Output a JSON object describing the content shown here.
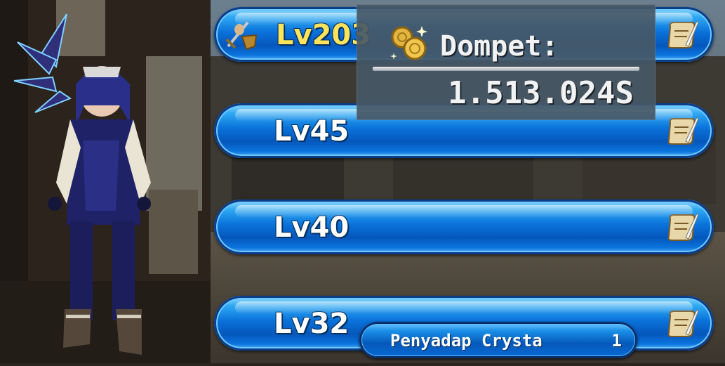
{
  "characters": [
    {
      "level": "Lv203"
    },
    {
      "level": "Lv45"
    },
    {
      "level": "Lv40"
    },
    {
      "level": "Lv32"
    }
  ],
  "wallet": {
    "label": "Dompet:",
    "amount": "1.513.024S"
  },
  "notice": {
    "item_name": "Penyadap Crysta",
    "quantity": "1"
  },
  "icons": {
    "weapon": "sword-shield-icon",
    "scroll": "scroll-quill-icon",
    "coins": "gold-coins-icon"
  },
  "colors": {
    "bar_blue": "#0a73db",
    "level_highlight": "#ffe45a",
    "wallet_panel": "#46586a"
  }
}
